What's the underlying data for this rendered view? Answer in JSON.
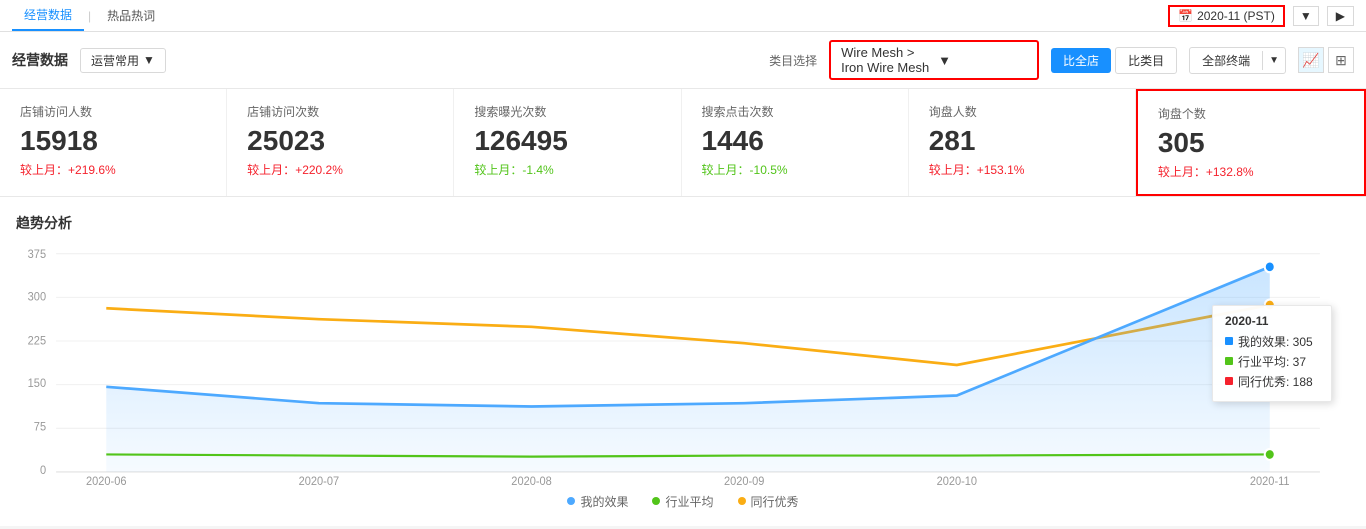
{
  "topNav": {
    "items": [
      {
        "label": "经营数据",
        "active": true
      },
      {
        "label": "热品热词",
        "active": false
      }
    ],
    "dateSelector": {
      "icon": "calendar-icon",
      "label": "2020-11 (PST)"
    }
  },
  "mainHeader": {
    "title": "经营数据",
    "dropdownLabel": "运营常用",
    "categoryLabel": "类目选择",
    "categoryValue": "Wire Mesh > Iron Wire Mesh",
    "buttons": {
      "compareAll": "比全店",
      "compareCategory": "比类目",
      "terminal": "全部终端"
    }
  },
  "metrics": [
    {
      "label": "店铺访问人数",
      "value": "15918",
      "changeLabel": "较上月：",
      "changeValue": "+219.6%",
      "changeType": "positive"
    },
    {
      "label": "店铺访问次数",
      "value": "25023",
      "changeLabel": "较上月：",
      "changeValue": "+220.2%",
      "changeType": "positive"
    },
    {
      "label": "搜索曝光次数",
      "value": "126495",
      "changeLabel": "较上月：",
      "changeValue": "-1.4%",
      "changeType": "negative"
    },
    {
      "label": "搜索点击次数",
      "value": "1446",
      "changeLabel": "较上月：",
      "changeValue": "-10.5%",
      "changeType": "negative"
    },
    {
      "label": "询盘人数",
      "value": "281",
      "changeLabel": "较上月：",
      "changeValue": "+153.1%",
      "changeType": "positive"
    },
    {
      "label": "询盘个数",
      "value": "305",
      "changeLabel": "较上月：",
      "changeValue": "+132.8%",
      "changeType": "positive",
      "highlighted": true
    }
  ],
  "chart": {
    "title": "趋势分析",
    "yAxisLabels": [
      "375",
      "300",
      "225",
      "150",
      "75",
      "0"
    ],
    "xAxisLabels": [
      "2020-06",
      "2020-07",
      "2020-08",
      "2020-09",
      "2020-10",
      "2020-11"
    ],
    "legend": [
      {
        "label": "我的效果",
        "color": "#4da9ff",
        "type": "circle"
      },
      {
        "label": "行业平均",
        "color": "#52c41a",
        "type": "circle"
      },
      {
        "label": "同行优秀",
        "color": "#faad14",
        "type": "circle"
      }
    ],
    "tooltip": {
      "date": "2020-11",
      "rows": [
        {
          "label": "我的效果: 305",
          "color": "#1890ff"
        },
        {
          "label": "行业平均: 37",
          "color": "#52c41a"
        },
        {
          "label": "同行优秀: 188",
          "color": "#f5222d"
        }
      ]
    }
  }
}
